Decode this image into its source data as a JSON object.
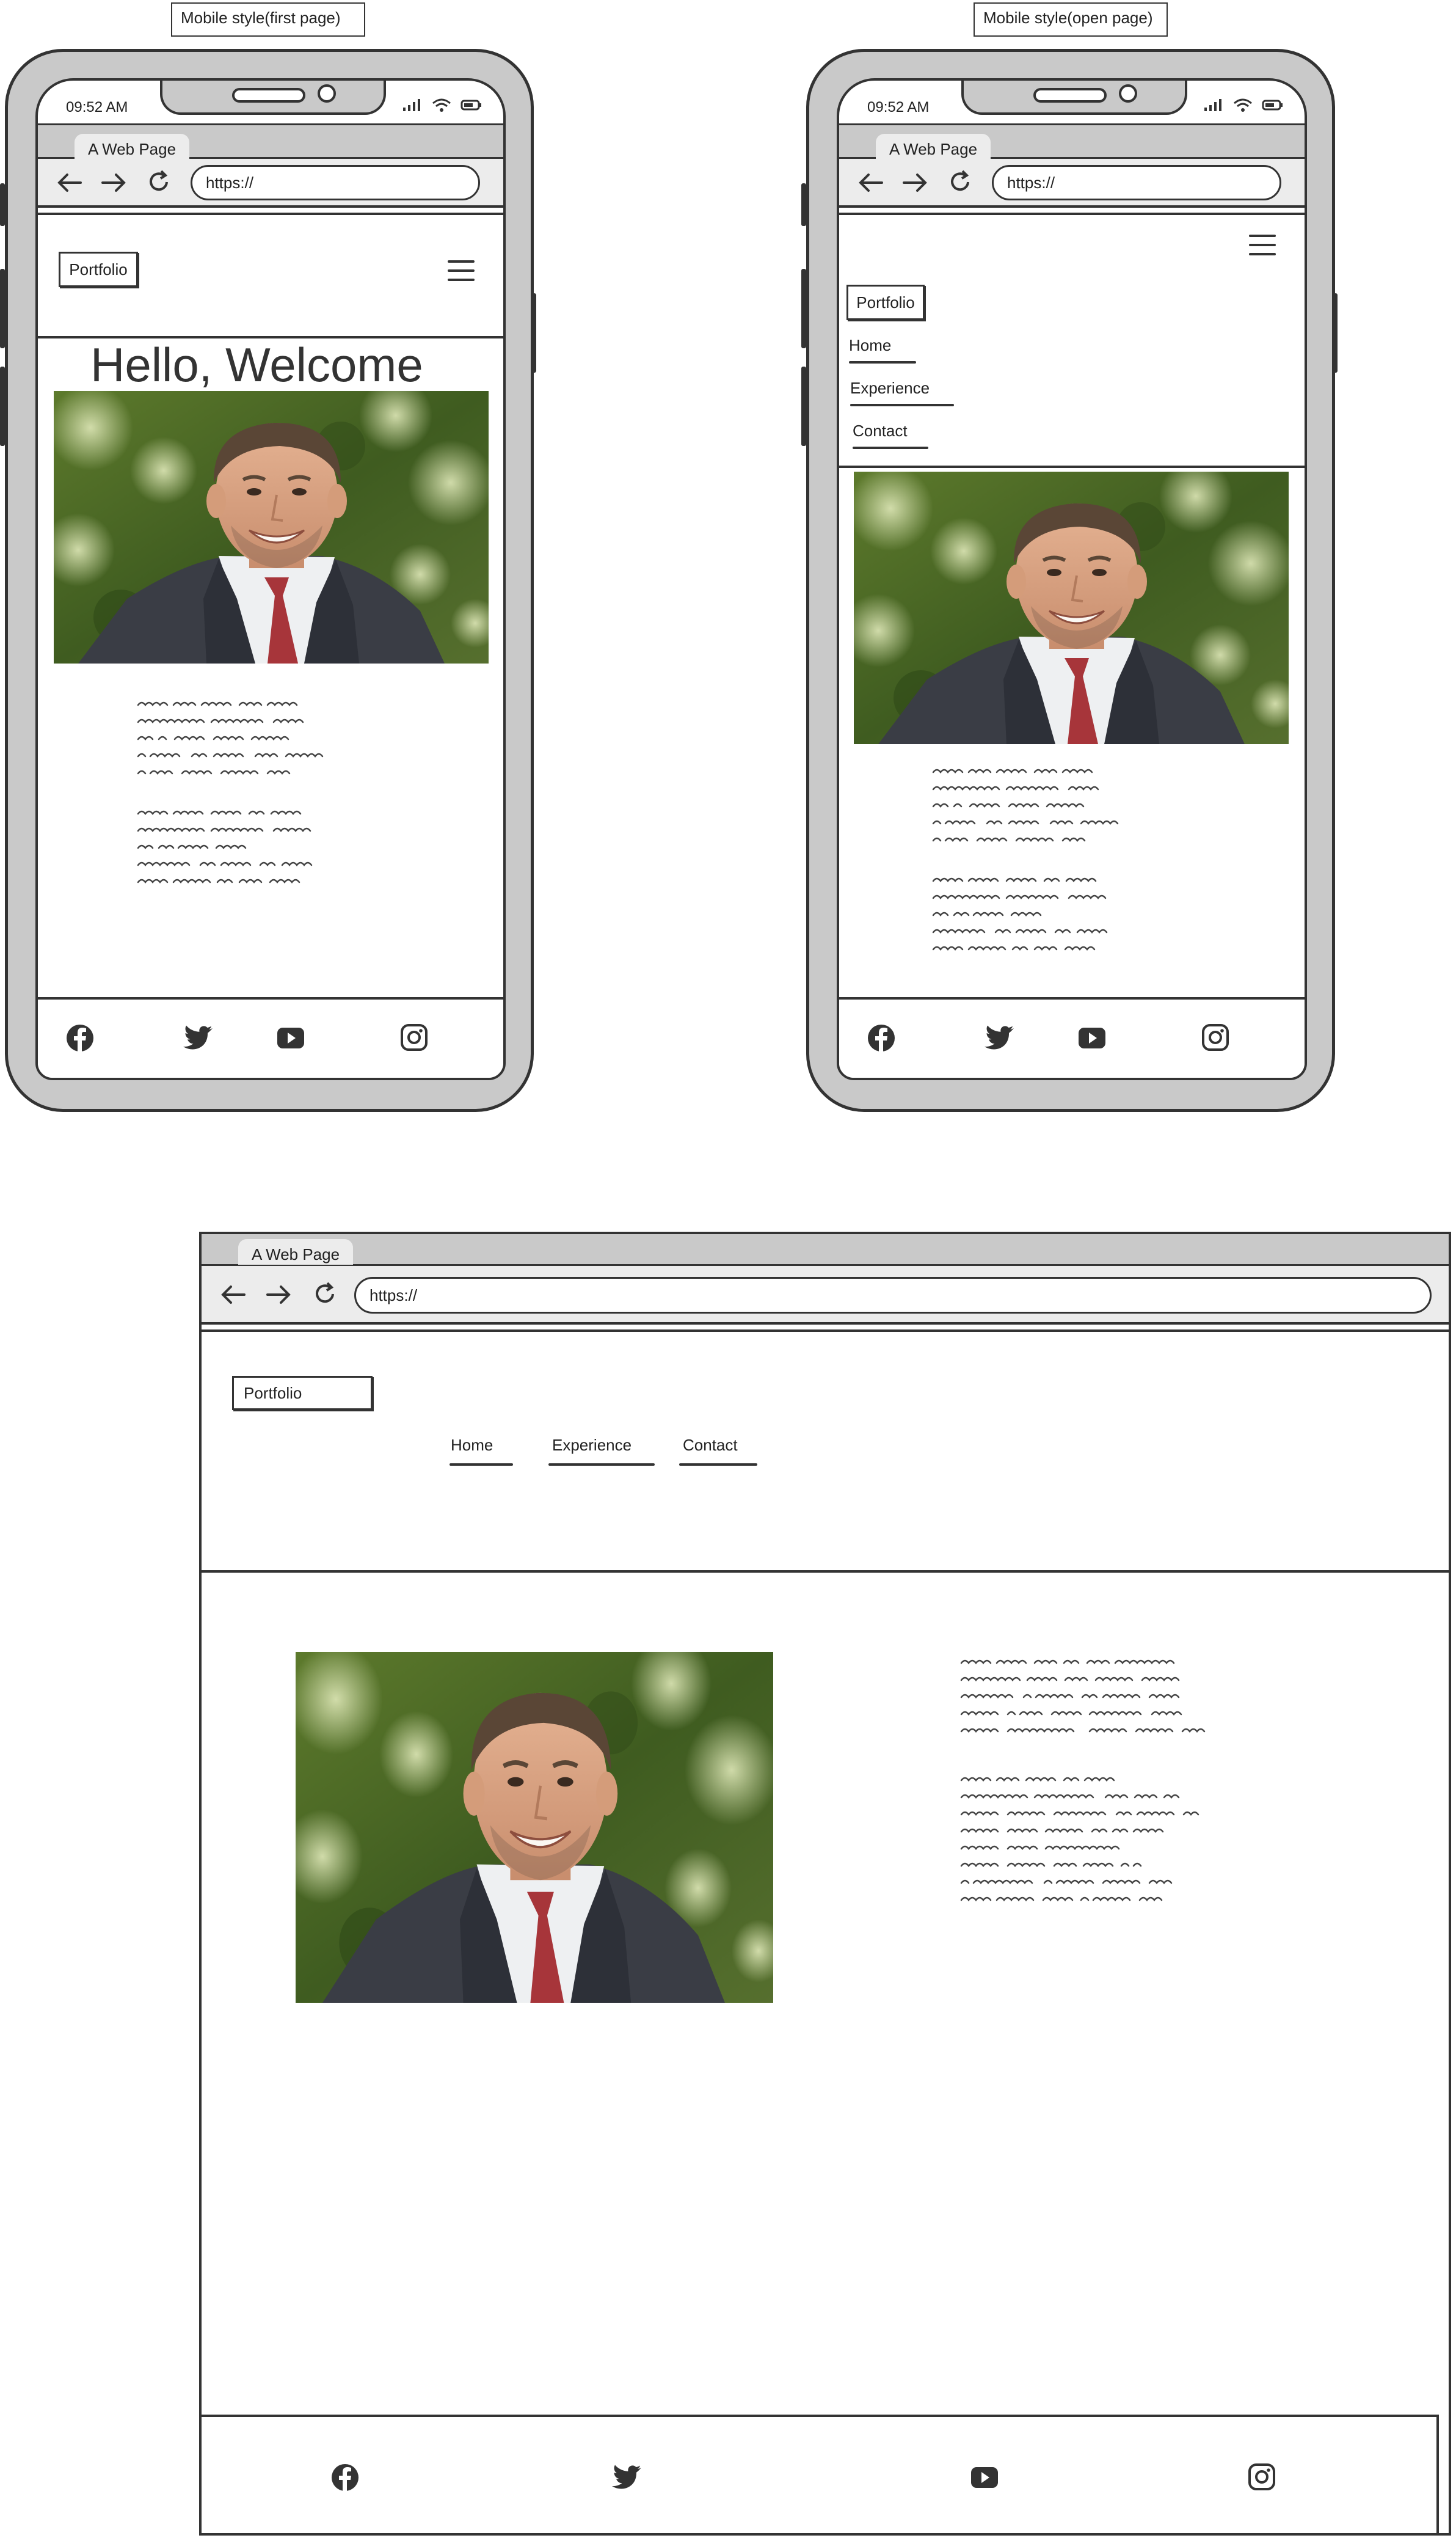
{
  "captions": {
    "mobile_first": "Mobile style(first page)",
    "mobile_open": "Mobile style(open page)"
  },
  "status": {
    "time": "09:52 AM"
  },
  "browser": {
    "tab_title": "A Web Page",
    "url": "https://"
  },
  "site": {
    "logo": "Portfolio",
    "welcome": "Hello, Welcome",
    "menu": [
      "Home",
      "Experience",
      "Contact"
    ],
    "socials": [
      "facebook-icon",
      "twitter-icon",
      "youtube-icon",
      "instagram-icon"
    ]
  },
  "colors": {
    "frame": "#c9c9c9",
    "stroke": "#333333",
    "chrome": "#ececec"
  }
}
